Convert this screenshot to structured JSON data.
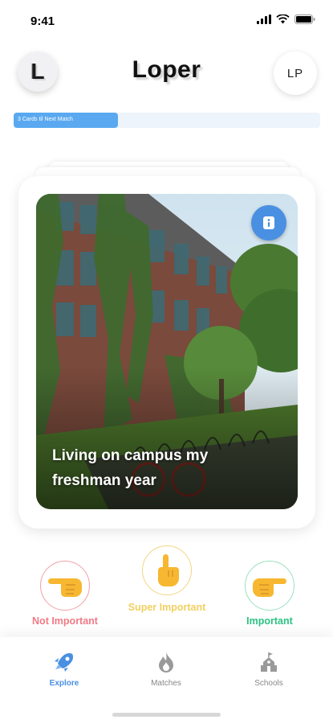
{
  "status_bar": {
    "time": "9:41"
  },
  "header": {
    "logo_letter": "L",
    "title": "Loper",
    "avatar_initials": "LP"
  },
  "progress": {
    "label": "3 Cards til Next Match",
    "fraction": 0.34
  },
  "card": {
    "caption": "Living on campus my freshman year",
    "info_icon": "info-icon"
  },
  "actions": [
    {
      "label": "Not Important",
      "icon": "finger-pointing-left-icon",
      "color": "#f07a86"
    },
    {
      "label": "Super Important",
      "icon": "finger-pointing-up-icon",
      "color": "#f0d060"
    },
    {
      "label": "Important",
      "icon": "finger-pointing-right-icon",
      "color": "#2cc283"
    }
  ],
  "tabs": [
    {
      "label": "Explore",
      "icon": "rocket-icon",
      "active": true
    },
    {
      "label": "Matches",
      "icon": "flame-icon",
      "active": false
    },
    {
      "label": "Schools",
      "icon": "school-building-icon",
      "active": false
    }
  ],
  "colors": {
    "accent": "#4a90e2",
    "progress": "#5aa9f0"
  }
}
